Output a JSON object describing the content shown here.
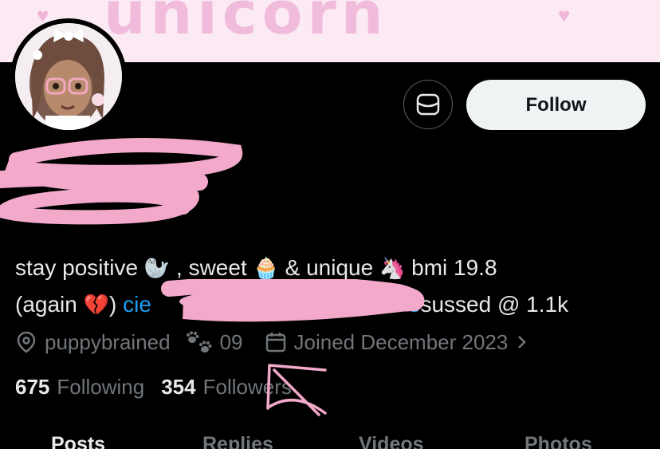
{
  "banner": {
    "text": "unicorn"
  },
  "actions": {
    "follow_label": "Follow",
    "message_icon": "envelope-icon"
  },
  "bio": {
    "line1_a": "stay positive",
    "line1_b": ", sweet",
    "line1_c": "& unique",
    "line1_d": "bmi 19.8",
    "line2_a": "(again",
    "line2_b": ")",
    "line2_link": "cie",
    "line2_link_end": "e",
    "line2_c": "sussed @ 1.1k",
    "emoji_seal": "🦭",
    "emoji_cupcake": "🧁",
    "emoji_unicorn": "🦄",
    "emoji_broken_heart": "💔"
  },
  "meta": {
    "location": "puppybrained",
    "paws_text": "09",
    "joined": "Joined December 2023"
  },
  "stats": {
    "following_count": "675",
    "following_label": "Following",
    "followers_count": "354",
    "followers_label": "Followers"
  },
  "tabs": [
    "Posts",
    "Replies",
    "Videos",
    "Photos"
  ],
  "colors": {
    "link": "#1d9bf0",
    "muted": "#71767b",
    "redaction": "#f3a9c9"
  }
}
